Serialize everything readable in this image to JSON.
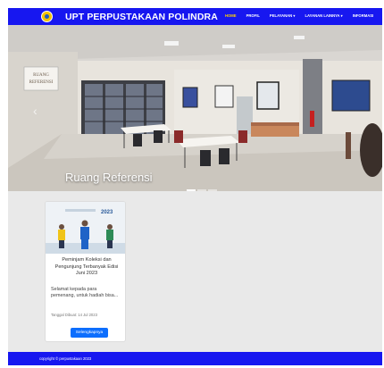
{
  "header": {
    "brand": "UPT PERPUSTAKAAN POLINDRA",
    "menu": [
      {
        "label": "HOME",
        "active": true
      },
      {
        "label": "PROFIL",
        "active": false
      },
      {
        "label": "PELAYANAN ▾",
        "active": false
      },
      {
        "label": "LAYANAN LAINNYA ▾",
        "active": false
      },
      {
        "label": "INFORMASI",
        "active": false
      }
    ]
  },
  "hero": {
    "caption": "Ruang Referensi",
    "sign_text": "RUANG REFERENSI",
    "prev_icon": "chevron-left-icon",
    "slides": 3,
    "active_slide": 1
  },
  "card": {
    "title": "Peminjam Koleksi dan Pengunjung Terbanyak Edisi Juni 2023",
    "excerpt": "Selamat kepada para pemenang, untuk hadiah bisa...",
    "date": "Tanggal Dibuat: 14 Jul 2023",
    "button": "Selengkapnya",
    "thumb_year": "2023"
  },
  "footer": {
    "text": "copyright © perpustakaan 2023"
  },
  "colors": {
    "primary": "#1717f0",
    "active_menu": "#ffd200",
    "button": "#0d6efd",
    "background": "#e9e9e9"
  }
}
